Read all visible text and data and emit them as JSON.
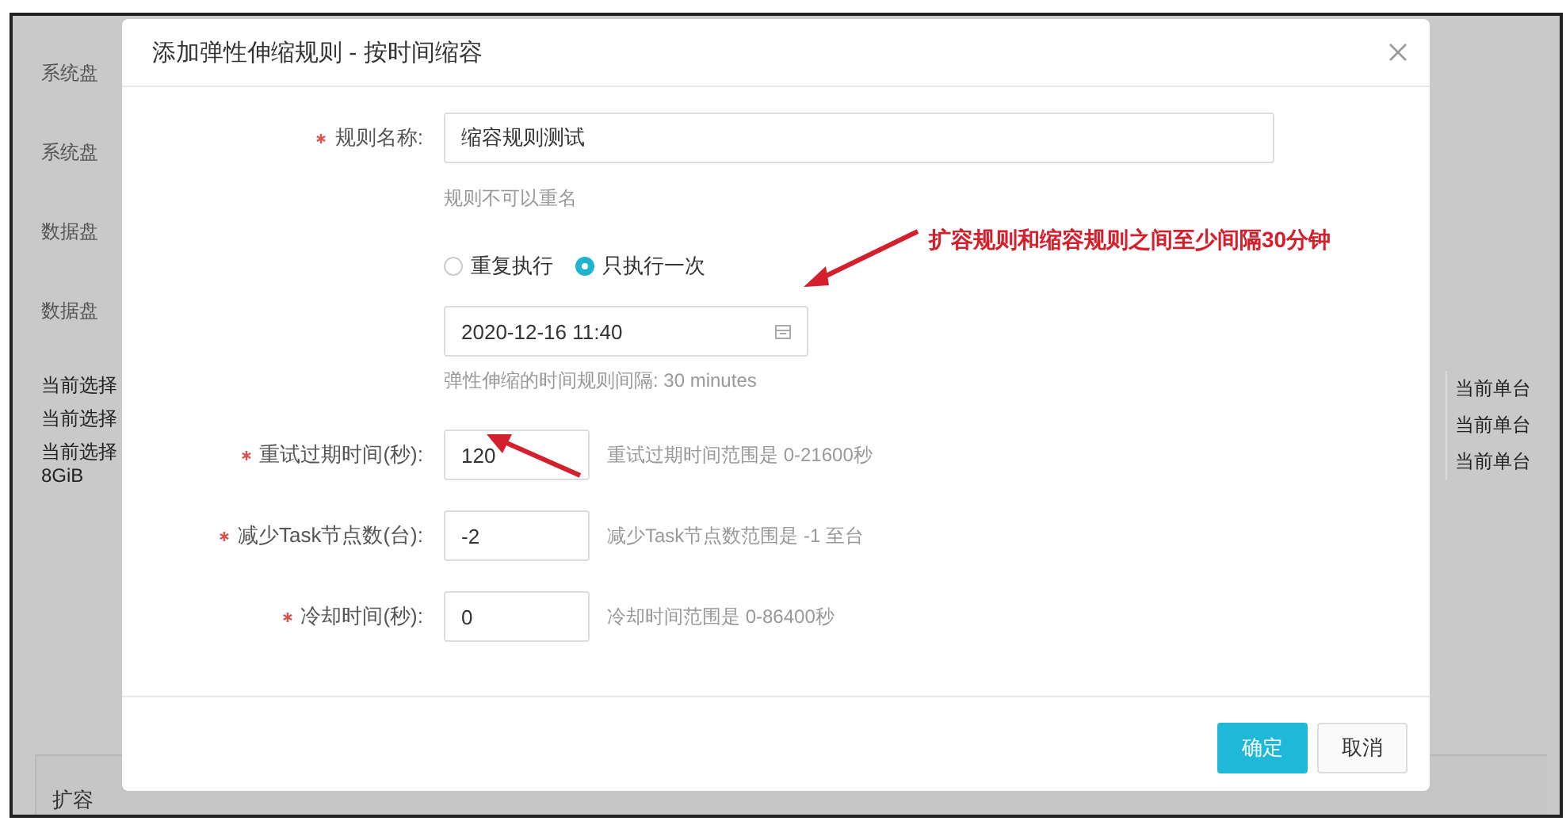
{
  "background": {
    "left_labels": [
      {
        "kind": "form_label",
        "text": "系统盘"
      },
      {
        "kind": "form_label",
        "text": "系统盘"
      },
      {
        "kind": "form_label",
        "text": "数据盘"
      },
      {
        "kind": "form_label",
        "text": "数据盘"
      },
      {
        "kind": "summary_line",
        "text": "当前选择"
      },
      {
        "kind": "summary_line",
        "text": "当前选择"
      },
      {
        "kind": "summary_line",
        "text": "当前选择"
      },
      {
        "kind": "summary_line",
        "text": "8GiB"
      }
    ],
    "section_title": "扩容",
    "right_labels": [
      "当前单台",
      "当前单台",
      "当前单台"
    ]
  },
  "dialog": {
    "title": "添加弹性伸缩规则 - 按时间缩容",
    "fields": [
      {
        "kind": "text",
        "label": "规则名称:",
        "required": true,
        "value": "缩容规则测试",
        "hint": "规则不可以重名"
      },
      {
        "kind": "radio",
        "options": [
          {
            "label": "重复执行",
            "selected": false
          },
          {
            "label": "只执行一次",
            "selected": true
          }
        ]
      },
      {
        "kind": "datetime",
        "value": "2020-12-16 11:40",
        "hint": "弹性伸缩的时间规则间隔: 30 minutes"
      },
      {
        "kind": "number",
        "label": "重试过期时间(秒):",
        "required": true,
        "value": "120",
        "note": "重试过期时间范围是 0-21600秒"
      },
      {
        "kind": "number",
        "label": "减少Task节点数(台):",
        "required": true,
        "value": "-2",
        "note": "减少Task节点数范围是 -1 至台"
      },
      {
        "kind": "number",
        "label": "冷却时间(秒):",
        "required": true,
        "value": "0",
        "note": "冷却时间范围是 0-86400秒"
      }
    ],
    "buttons": [
      {
        "kind": "primary",
        "label": "确定"
      },
      {
        "kind": "default",
        "label": "取消"
      }
    ]
  },
  "annotations": [
    {
      "kind": "callout",
      "text": "扩容规则和缩容规则之间至少间隔30分钟"
    },
    {
      "kind": "arrow"
    },
    {
      "kind": "arrow"
    }
  ]
}
